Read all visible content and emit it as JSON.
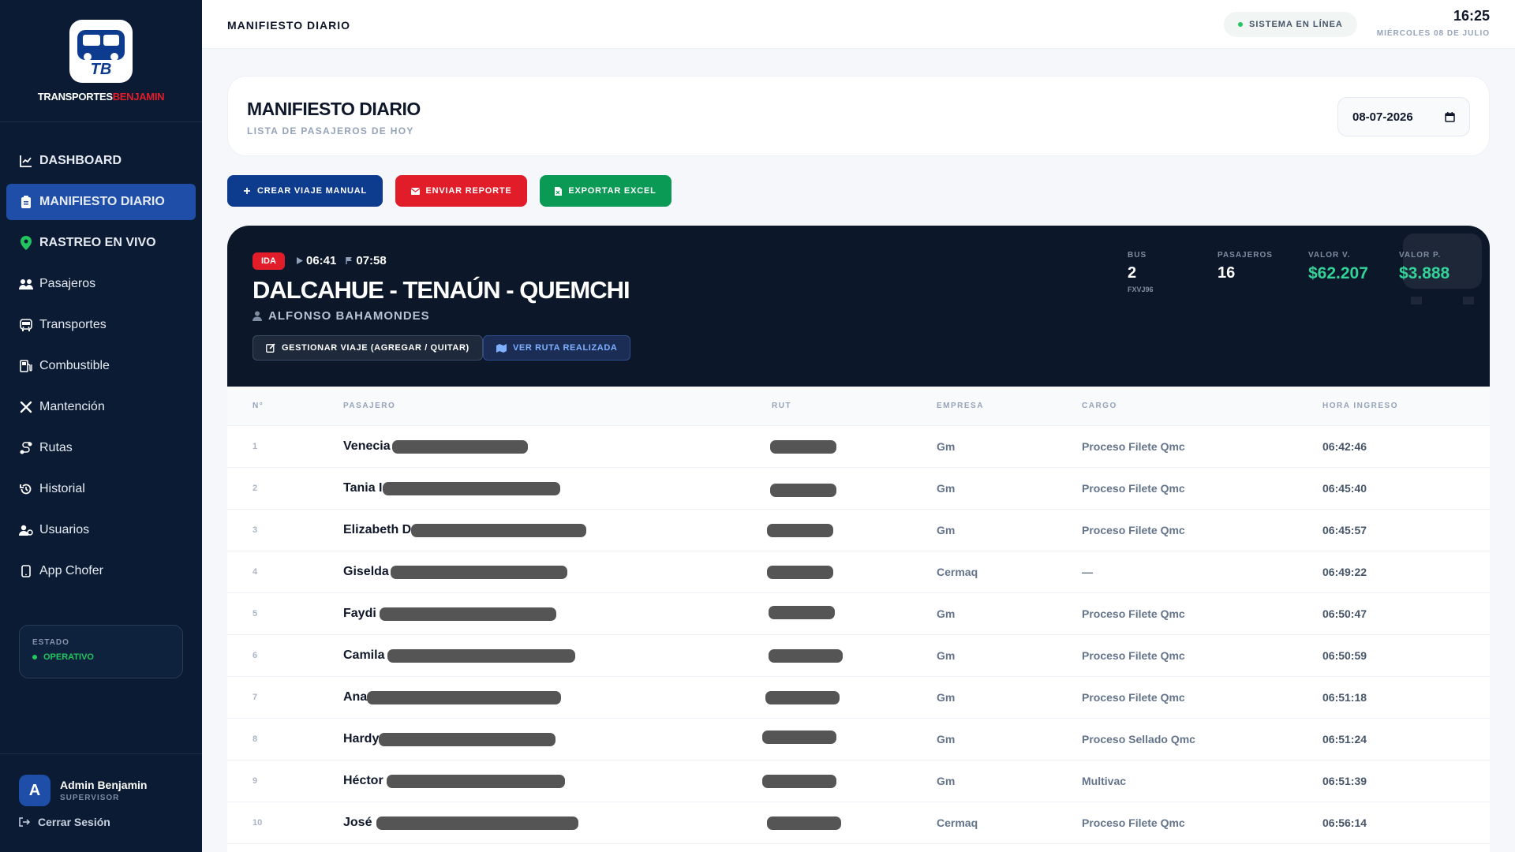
{
  "brand": {
    "name_a": "TRANSPORTES",
    "name_b": "BENJAMIN",
    "logo_initials": "TB"
  },
  "nav": [
    {
      "label": "DASHBOARD",
      "icon": "chart-line-icon"
    },
    {
      "label": "MANIFIESTO DIARIO",
      "icon": "clipboard-icon"
    },
    {
      "label": "RASTREO EN VIVO",
      "icon": "map-pin-icon"
    },
    {
      "label": "Pasajeros",
      "icon": "users-icon"
    },
    {
      "label": "Transportes",
      "icon": "bus-icon"
    },
    {
      "label": "Combustible",
      "icon": "gas-pump-icon"
    },
    {
      "label": "Mantención",
      "icon": "tools-icon"
    },
    {
      "label": "Rutas",
      "icon": "route-icon"
    },
    {
      "label": "Historial",
      "icon": "history-icon"
    },
    {
      "label": "Usuarios",
      "icon": "user-cog-icon"
    },
    {
      "label": "App Chofer",
      "icon": "mobile-icon"
    }
  ],
  "status": {
    "label": "ESTADO",
    "value": "OPERATIVO",
    "color": "#22c55e"
  },
  "user": {
    "initial": "A",
    "name": "Admin Benjamin",
    "role": "SUPERVISOR",
    "logout": "Cerrar Sesión"
  },
  "topbar": {
    "title": "MANIFIESTO DIARIO",
    "system": "SISTEMA EN LÍNEA",
    "time": "16:25",
    "date": "MIÉRCOLES 08 DE JULIO"
  },
  "header": {
    "title": "MANIFIESTO DIARIO",
    "subtitle": "LISTA DE PASAJEROS DE HOY",
    "date_value": "08-07-2026"
  },
  "actions": {
    "create": "CREAR VIAJE MANUAL",
    "report": "ENVIAR REPORTE",
    "export": "EXPORTAR EXCEL"
  },
  "trip": {
    "direction": "IDA",
    "start": "06:41",
    "end": "07:58",
    "route": "DALCAHUE - TENAÚN - QUEMCHI",
    "driver": "ALFONSO BAHAMONDES",
    "manage": "GESTIONAR VIAJE (AGREGAR / QUITAR)",
    "view_route": "VER RUTA REALIZADA",
    "stats": {
      "bus_label": "BUS",
      "bus_value": "2",
      "bus_plate": "FXVJ96",
      "pax_label": "PASAJEROS",
      "pax_value": "16",
      "vv_label": "VALOR V.",
      "vv_value": "$62.207",
      "vp_label": "VALOR P.",
      "vp_value": "$3.888"
    }
  },
  "table": {
    "headers": {
      "n": "N°",
      "p": "PASAJERO",
      "r": "RUT",
      "e": "EMPRESA",
      "c": "CARGO",
      "h": "HORA INGRESO"
    },
    "rows": [
      {
        "n": "1",
        "name": "Venecia",
        "empresa": "Gm",
        "cargo": "Proceso Filete Qmc",
        "hora": "06:42:46"
      },
      {
        "n": "2",
        "name": "Tania I",
        "empresa": "Gm",
        "cargo": "Proceso Filete Qmc",
        "hora": "06:45:40"
      },
      {
        "n": "3",
        "name": "Elizabeth D",
        "empresa": "Gm",
        "cargo": "Proceso Filete Qmc",
        "hora": "06:45:57"
      },
      {
        "n": "4",
        "name": "Giselda",
        "empresa": "Cermaq",
        "cargo": "—",
        "hora": "06:49:22"
      },
      {
        "n": "5",
        "name": "Faydi",
        "empresa": "Gm",
        "cargo": "Proceso Filete Qmc",
        "hora": "06:50:47"
      },
      {
        "n": "6",
        "name": "Camila",
        "empresa": "Gm",
        "cargo": "Proceso Filete Qmc",
        "hora": "06:50:59"
      },
      {
        "n": "7",
        "name": "Ana",
        "empresa": "Gm",
        "cargo": "Proceso Filete Qmc",
        "hora": "06:51:18"
      },
      {
        "n": "8",
        "name": "Hardy",
        "empresa": "Gm",
        "cargo": "Proceso Sellado Qmc",
        "hora": "06:51:24"
      },
      {
        "n": "9",
        "name": "Héctor",
        "empresa": "Gm",
        "cargo": "Multivac",
        "hora": "06:51:39"
      },
      {
        "n": "10",
        "name": "José",
        "empresa": "Cermaq",
        "cargo": "Proceso Filete Qmc",
        "hora": "06:56:14"
      }
    ]
  }
}
